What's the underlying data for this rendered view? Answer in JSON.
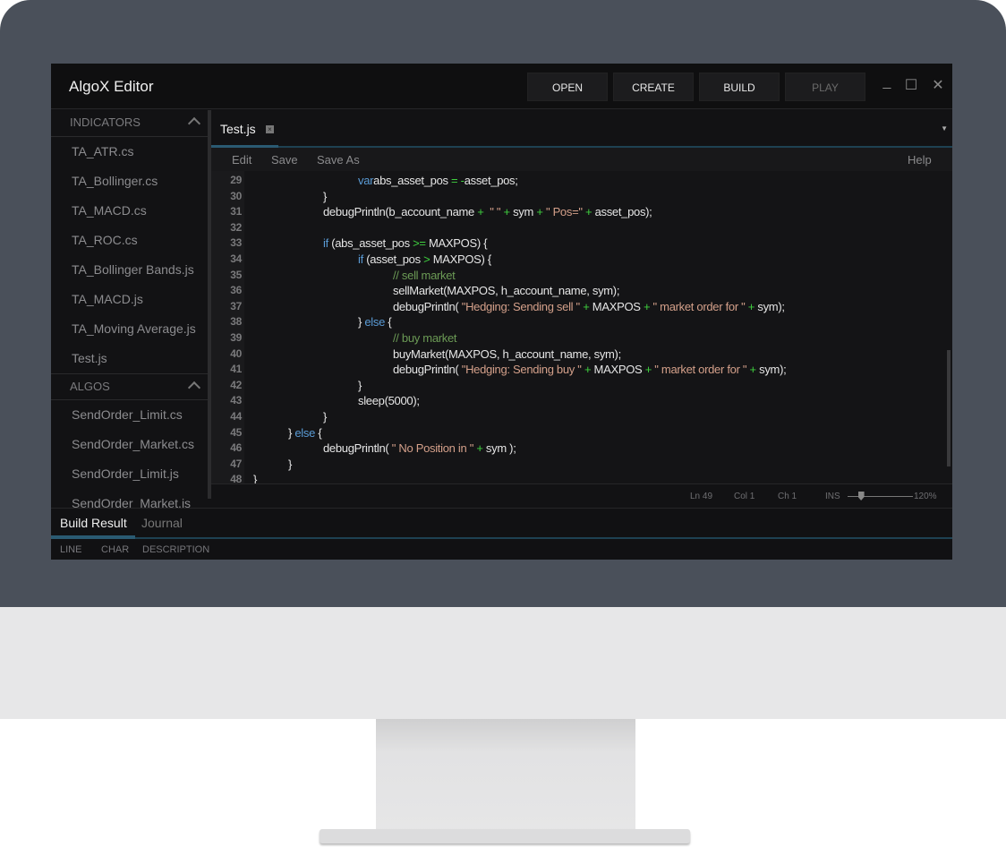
{
  "app": {
    "title": "AlgoX Editor"
  },
  "toolbar": {
    "open": "OPEN",
    "create": "CREATE",
    "build": "BUILD",
    "play": "PLAY"
  },
  "window_controls": {
    "minimize": "_",
    "maximize": "☐",
    "close": "✕"
  },
  "sidebar": {
    "sections": [
      {
        "title": "INDICATORS",
        "items": [
          "TA_ATR.cs",
          "TA_Bollinger.cs",
          "TA_MACD.cs",
          "TA_ROC.cs",
          "TA_Bollinger Bands.js",
          "TA_MACD.js",
          "TA_Moving Average.js",
          "Test.js"
        ]
      },
      {
        "title": "ALGOS",
        "items": [
          "SendOrder_Limit.cs",
          "SendOrder_Market.cs",
          "SendOrder_Limit.js",
          "SendOrder_Market.js"
        ]
      }
    ]
  },
  "editor": {
    "tab": "Test.js",
    "menu": {
      "edit": "Edit",
      "save": "Save",
      "save_as": "Save As",
      "help": "Help"
    },
    "lines": [
      {
        "n": "29",
        "indent": 3,
        "tokens": [
          [
            "kw",
            "var"
          ],
          [
            "",
            "abs_asset_pos "
          ],
          [
            "op",
            "="
          ],
          [
            "",
            " "
          ],
          [
            "op",
            "-"
          ],
          [
            "",
            "asset_pos;"
          ]
        ]
      },
      {
        "n": "30",
        "indent": 2,
        "tokens": [
          [
            "",
            "}"
          ]
        ]
      },
      {
        "n": "31",
        "indent": 2,
        "tokens": [
          [
            "",
            "debugPrintln(b_account_name "
          ],
          [
            "op",
            "+"
          ],
          [
            "",
            "  "
          ],
          [
            "str",
            "\" \""
          ],
          [
            "",
            " "
          ],
          [
            "op",
            "+"
          ],
          [
            "",
            " sym "
          ],
          [
            "op",
            "+"
          ],
          [
            "",
            " "
          ],
          [
            "str",
            "\" Pos=\""
          ],
          [
            "",
            " "
          ],
          [
            "op",
            "+"
          ],
          [
            "",
            " asset_pos);"
          ]
        ]
      },
      {
        "n": "32",
        "indent": 0,
        "tokens": []
      },
      {
        "n": "33",
        "indent": 2,
        "tokens": [
          [
            "kw",
            "if"
          ],
          [
            "",
            " (abs_asset_pos "
          ],
          [
            "op",
            ">="
          ],
          [
            "",
            " MAXPOS) {"
          ]
        ]
      },
      {
        "n": "34",
        "indent": 3,
        "tokens": [
          [
            "kw",
            "if"
          ],
          [
            "",
            " (asset_pos "
          ],
          [
            "op",
            ">"
          ],
          [
            "",
            " MAXPOS) {"
          ]
        ]
      },
      {
        "n": "35",
        "indent": 4,
        "tokens": [
          [
            "cmt",
            "// sell market"
          ]
        ]
      },
      {
        "n": "36",
        "indent": 4,
        "tokens": [
          [
            "",
            "sellMarket(MAXPOS, h_account_name, sym);"
          ]
        ]
      },
      {
        "n": "37",
        "indent": 4,
        "tokens": [
          [
            "",
            "debugPrintln( "
          ],
          [
            "str",
            "\"Hedging: Sending sell \""
          ],
          [
            "",
            " "
          ],
          [
            "op",
            "+"
          ],
          [
            "",
            " MAXPOS "
          ],
          [
            "op",
            "+"
          ],
          [
            "",
            " "
          ],
          [
            "str",
            "\" market order for \""
          ],
          [
            "",
            " "
          ],
          [
            "op",
            "+"
          ],
          [
            "",
            " sym);"
          ]
        ]
      },
      {
        "n": "38",
        "indent": 3,
        "tokens": [
          [
            "",
            "} "
          ],
          [
            "kw",
            "else"
          ],
          [
            "",
            " {"
          ]
        ]
      },
      {
        "n": "39",
        "indent": 4,
        "tokens": [
          [
            "cmt",
            "// buy market"
          ]
        ]
      },
      {
        "n": "40",
        "indent": 4,
        "tokens": [
          [
            "",
            "buyMarket(MAXPOS, h_account_name, sym);"
          ]
        ]
      },
      {
        "n": "41",
        "indent": 4,
        "tokens": [
          [
            "",
            "debugPrintln( "
          ],
          [
            "str",
            "\"Hedging: Sending buy \""
          ],
          [
            "",
            " "
          ],
          [
            "op",
            "+"
          ],
          [
            "",
            " MAXPOS "
          ],
          [
            "op",
            "+"
          ],
          [
            "",
            " "
          ],
          [
            "str",
            "\" market order for \""
          ],
          [
            "",
            " "
          ],
          [
            "op",
            "+"
          ],
          [
            "",
            " sym);"
          ]
        ]
      },
      {
        "n": "42",
        "indent": 3,
        "tokens": [
          [
            "",
            "}"
          ]
        ]
      },
      {
        "n": "43",
        "indent": 3,
        "tokens": [
          [
            "",
            "sleep(5000);"
          ]
        ]
      },
      {
        "n": "44",
        "indent": 2,
        "tokens": [
          [
            "",
            "}"
          ]
        ]
      },
      {
        "n": "45",
        "indent": 1,
        "tokens": [
          [
            "",
            "} "
          ],
          [
            "kw",
            "else"
          ],
          [
            "",
            " {"
          ]
        ]
      },
      {
        "n": "46",
        "indent": 2,
        "tokens": [
          [
            "",
            "debugPrintln( "
          ],
          [
            "str",
            "\" No Position in \""
          ],
          [
            "",
            " "
          ],
          [
            "op",
            "+"
          ],
          [
            "",
            " sym );"
          ]
        ]
      },
      {
        "n": "47",
        "indent": 1,
        "tokens": [
          [
            "",
            "}"
          ]
        ]
      },
      {
        "n": "48",
        "indent": 0,
        "tokens": [
          [
            "",
            "}"
          ]
        ]
      }
    ],
    "status": {
      "line": "Ln 49",
      "col": "Col 1",
      "ch": "Ch 1",
      "mode": "INS",
      "zoom": "120%",
      "zoom_level": 120
    }
  },
  "bottom_panel": {
    "tabs": [
      "Build Result",
      "Journal"
    ],
    "columns": [
      "LINE",
      "CHAR",
      "DESCRIPTION"
    ]
  }
}
